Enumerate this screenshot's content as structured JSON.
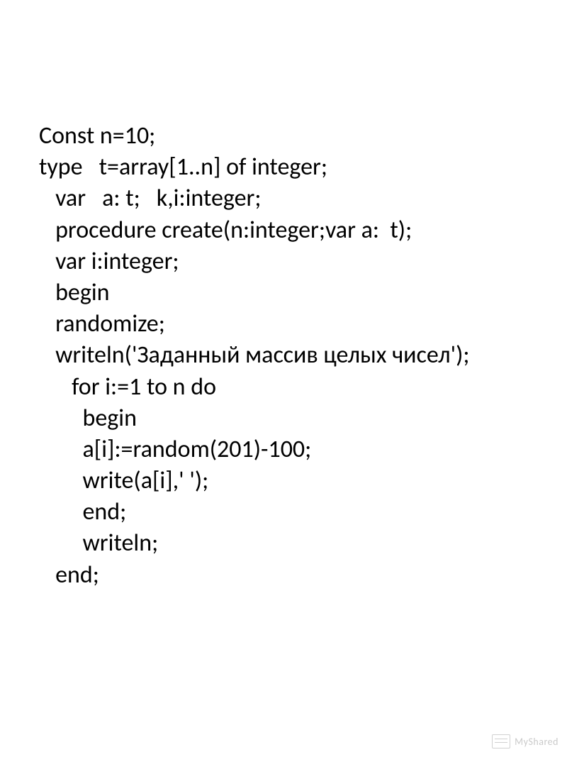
{
  "code": {
    "lines": [
      "Const n=10;",
      "type   t=array[1..n] of integer;",
      "   var   a: t;   k,i:integer;",
      "   procedure create(n:integer;var a:  t);",
      "   var i:integer;",
      "   begin",
      "   randomize;",
      "   writeln('Заданный массив целых чисел');",
      "      for i:=1 to n do",
      "        begin",
      "        a[i]:=random(201)-100;",
      "        write(a[i],' ');",
      "        end;",
      "        writeln;",
      "   end;"
    ]
  },
  "watermark": {
    "text": "MyShared"
  }
}
